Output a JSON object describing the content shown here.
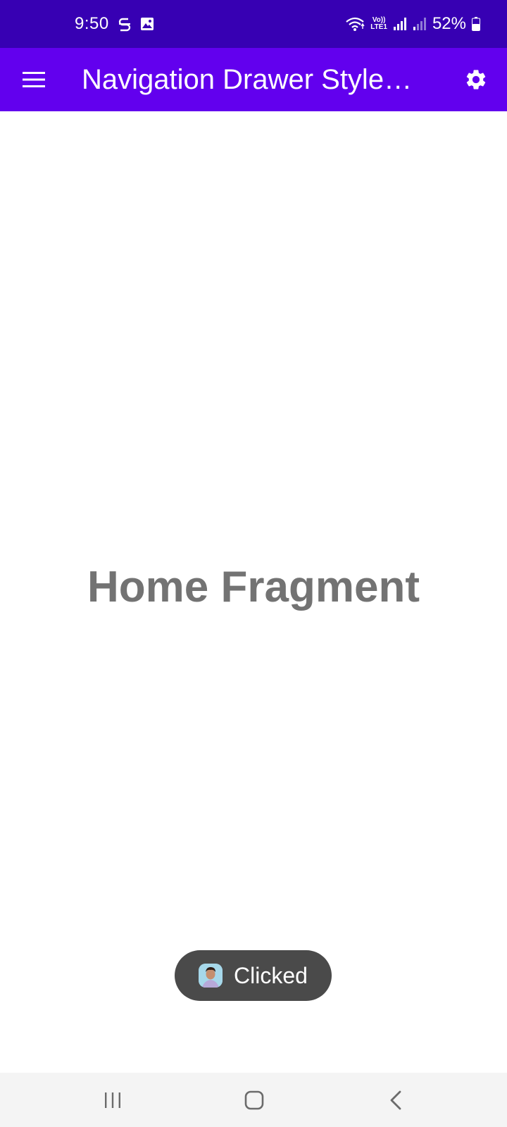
{
  "status_bar": {
    "time": "9:50",
    "volte_top": "Vo))",
    "volte_bottom": "LTE1",
    "battery": "52%",
    "icons": [
      "sync-s-icon",
      "image-icon",
      "wifi-icon",
      "volte-icon",
      "signal-icon",
      "signal-weak-icon",
      "battery-icon"
    ]
  },
  "toolbar": {
    "title": "Navigation Drawer Style…",
    "menu_icon": "hamburger-menu-icon",
    "settings_icon": "gear-icon"
  },
  "content": {
    "fragment_label": "Home Fragment"
  },
  "toast": {
    "text": "Clicked",
    "icon": "app-avatar-icon"
  },
  "nav_bar": {
    "icons": [
      "recents-icon",
      "home-icon",
      "back-icon"
    ]
  },
  "colors": {
    "status_bar": "#3700B3",
    "toolbar": "#6200EE",
    "fragment_text": "#737373",
    "toast_bg": "#4a4a4a",
    "nav_bar": "#f4f4f4"
  }
}
